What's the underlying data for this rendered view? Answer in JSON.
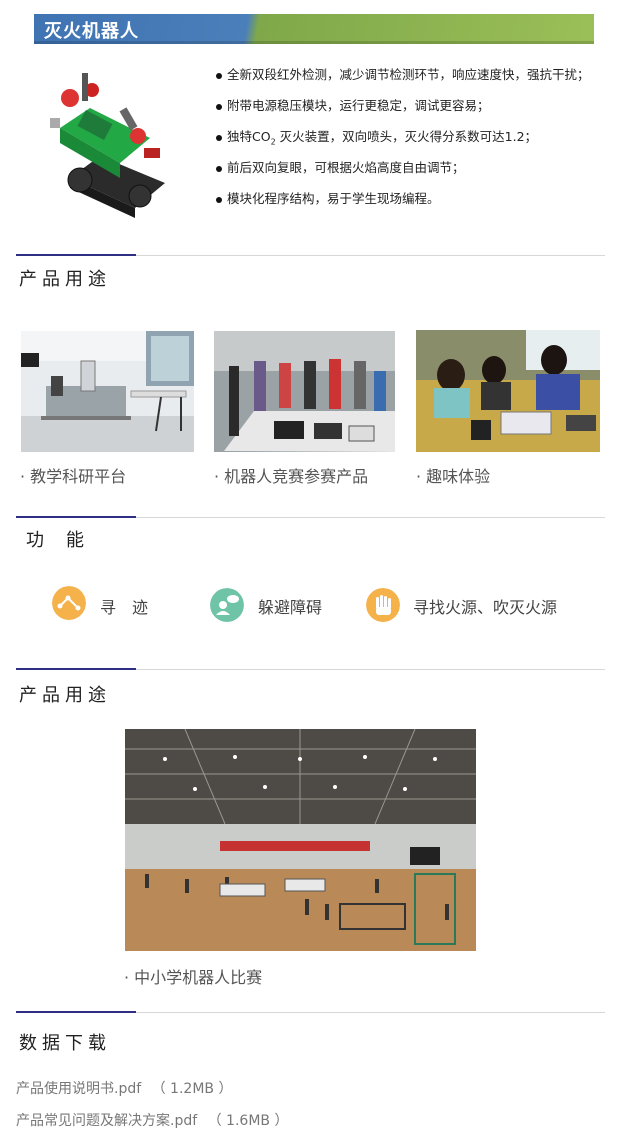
{
  "header": {
    "title": "灭火机器人"
  },
  "features": [
    "全新双段红外检测，减少调节检测环节，响应速度快，强抗干扰；",
    "附带电源稳压模块，运行更稳定，调试更容易；",
    {
      "pre": "独特CO",
      "sub": "2",
      "post": " 灭火装置，双向喷头，灭火得分系数可达1.2；"
    },
    "前后双向复眼，可根据火焰高度自由调节；",
    "模块化程序结构，易于学生现场编程。"
  ],
  "section_usage": {
    "title": "产品用途",
    "items": [
      {
        "label": "· 教学科研平台"
      },
      {
        "label": "· 机器人竞赛参赛产品"
      },
      {
        "label": "· 趣味体验"
      }
    ]
  },
  "section_function": {
    "title": "功　能",
    "items": [
      {
        "label": "寻　迹",
        "icon": "route-icon",
        "color": "#f5b14a"
      },
      {
        "label": "躲避障碍",
        "icon": "person-chat-icon",
        "color": "#6fc3a6"
      },
      {
        "label": "寻找火源、吹灭火源",
        "icon": "fire-hand-icon",
        "color": "#f5b14a"
      }
    ]
  },
  "section_usage2": {
    "title": "产品用途",
    "caption": "· 中小学机器人比赛"
  },
  "section_download": {
    "title": "数据下载",
    "files": [
      {
        "name": "产品使用说明书.pdf",
        "size": "（ 1.2MB ）"
      },
      {
        "name": "产品常见问题及解决方案.pdf",
        "size": "（ 1.6MB ）"
      }
    ]
  },
  "colors": {
    "accent": "#2d2e84",
    "header_blue": "#3f73b2",
    "header_green": "#9bbf58"
  }
}
